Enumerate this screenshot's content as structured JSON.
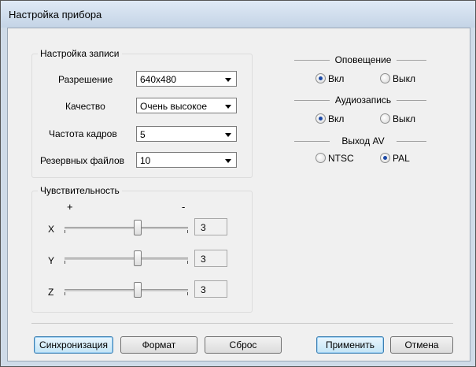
{
  "window": {
    "title": "Настройка прибора"
  },
  "recording": {
    "group_label": "Настройка записи",
    "rows": [
      {
        "label": "Разрешение",
        "value": "640x480"
      },
      {
        "label": "Качество",
        "value": "Очень высокое"
      },
      {
        "label": "Частота кадров",
        "value": "5"
      },
      {
        "label": "Резервных файлов",
        "value": "10"
      }
    ]
  },
  "sensitivity": {
    "group_label": "Чувствительность",
    "plus": "+",
    "minus": "-",
    "axes": [
      {
        "label": "X",
        "value": "3",
        "level": 0.5
      },
      {
        "label": "Y",
        "value": "3",
        "level": 0.5
      },
      {
        "label": "Z",
        "value": "3",
        "level": 0.5
      }
    ]
  },
  "notification": {
    "title": "Оповещение",
    "on_label": "Вкл",
    "off_label": "Выкл",
    "selected": "on"
  },
  "audio": {
    "title": "Аудиозапись",
    "on_label": "Вкл",
    "off_label": "Выкл",
    "selected": "on"
  },
  "av_out": {
    "title": "Выход AV",
    "ntsc_label": "NTSC",
    "pal_label": "PAL",
    "selected": "pal"
  },
  "buttons": {
    "sync": "Синхронизация",
    "format": "Формат",
    "reset": "Сброс",
    "apply": "Применить",
    "cancel": "Отмена"
  }
}
